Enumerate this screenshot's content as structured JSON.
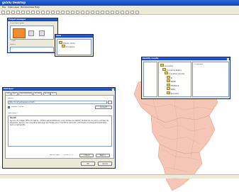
{
  "window": {
    "title": "gvSIG Desktop"
  },
  "menu": [
    "File",
    "View",
    "Layer",
    "Window",
    "View",
    "Help"
  ],
  "toolbar_icon_count": 28,
  "project_manager": {
    "title": "Project manager",
    "section": "Document types",
    "doc_types": [
      "View",
      "Table",
      "Map"
    ],
    "toc_entry": "Cusum",
    "open_view_title": "View",
    "list_items": [
      "1",
      "2",
      "3"
    ]
  },
  "view_toc": {
    "layer": "Distrito_Clima",
    "sublayer": "Concelhos"
  },
  "layer_dialog": {
    "title": "Add layer",
    "tabs": [
      "File",
      "GPX",
      "GeoDatabase",
      "ArcIMS",
      "WMS",
      "WFS"
    ],
    "active_tab": "WFS",
    "server_label": "Server",
    "server_url": "http://localhost/geoserver/wfs",
    "checkbox_label": "Refresh cache",
    "connect_button": "Connect",
    "description_label": "Description",
    "description_title": "Result",
    "description_text": "Serviço de mapas WFS Concelhos - limites administrativos. Inclui limites de distrito, limites de concelho e limites de freguesia. Serviço de consulta e descarga de limites para o território nacional, informação de base administrativa para a cartografia.",
    "service_type_label": "Server type",
    "service_type_value": "WMS 1.1.1",
    "back_button": "< Back",
    "next_button": "Next >",
    "cancel_button": "Cancel",
    "ok_button": "OK"
  },
  "identify_dialog": {
    "title": "Identify results",
    "tree": [
      "Concelhos",
      "Concelhos feature",
      "Concelhos_bounds",
      "ID",
      "NAME",
      "DISTRICT",
      "AREA",
      "geometry"
    ],
    "value": "Portalegre"
  },
  "colors": {
    "map_fill": "#f5c6b6",
    "map_stroke": "#d9a392",
    "title_blue": "#2459c9"
  }
}
